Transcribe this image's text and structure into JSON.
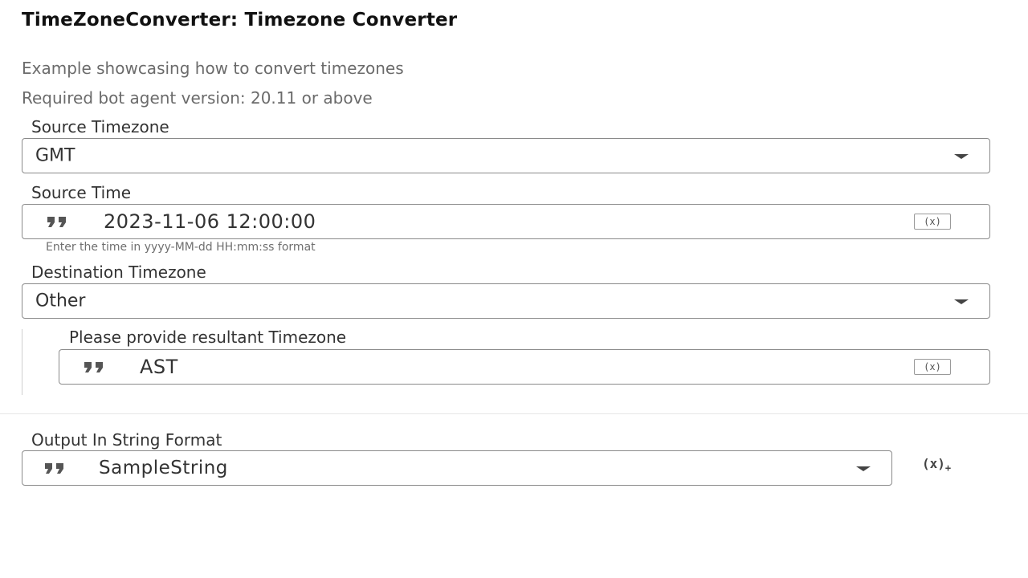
{
  "header": {
    "title": "TimeZoneConverter: Timezone Converter",
    "description": "Example showcasing how to convert timezones",
    "version_note": "Required bot agent version: 20.11 or above"
  },
  "source_timezone": {
    "label": "Source Timezone",
    "value": "GMT"
  },
  "source_time": {
    "label": "Source Time",
    "value": "2023-11-06 12:00:00",
    "hint": "Enter the time in yyyy-MM-dd HH:mm:ss format",
    "var_button": "(x)"
  },
  "destination_timezone": {
    "label": "Destination Timezone",
    "value": "Other"
  },
  "resultant_timezone": {
    "label": "Please provide resultant Timezone",
    "value": "AST",
    "var_button": "(x)"
  },
  "output": {
    "label": "Output In String Format",
    "value": "SampleString",
    "add_var_button": "(x)",
    "add_var_plus": "+"
  },
  "icons": {
    "quote": "quote-icon",
    "caret": "chevron-down-icon",
    "variable": "variable-icon",
    "add_variable": "add-variable-icon"
  }
}
